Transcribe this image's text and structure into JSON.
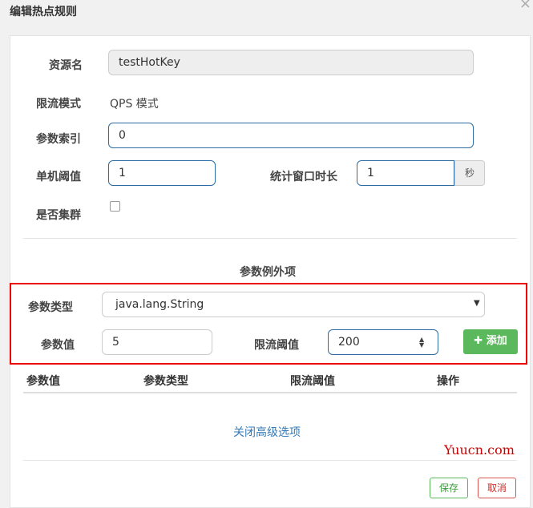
{
  "dialog": {
    "title": "编辑热点规则",
    "close_label": "×"
  },
  "form": {
    "resource_label": "资源名",
    "resource_value": "testHotKey",
    "mode_label": "限流模式",
    "mode_value": "QPS 模式",
    "param_index_label": "参数索引",
    "param_index_value": "0",
    "threshold_label": "单机阈值",
    "threshold_value": "1",
    "window_label": "统计窗口时长",
    "window_value": "1",
    "window_unit": "秒",
    "cluster_label": "是否集群",
    "cluster_checked": false
  },
  "exception": {
    "section_title": "参数例外项",
    "param_type_label": "参数类型",
    "param_type_value": "java.lang.String",
    "param_value_label": "参数值",
    "param_value_value": "5",
    "limit_label": "限流阈值",
    "limit_value": "200",
    "add_button_label": "添加"
  },
  "table": {
    "headers": [
      "参数值",
      "参数类型",
      "限流阈值",
      "操作"
    ]
  },
  "advanced_link": "关闭高级选项",
  "footer": {
    "save_label": "保存",
    "cancel_label": "取消"
  },
  "watermark": "Yuucn.com",
  "colors": {
    "accent": "#337ab7",
    "success": "#5cb85c",
    "danger": "#d9534f",
    "highlight": "#ee0000"
  }
}
